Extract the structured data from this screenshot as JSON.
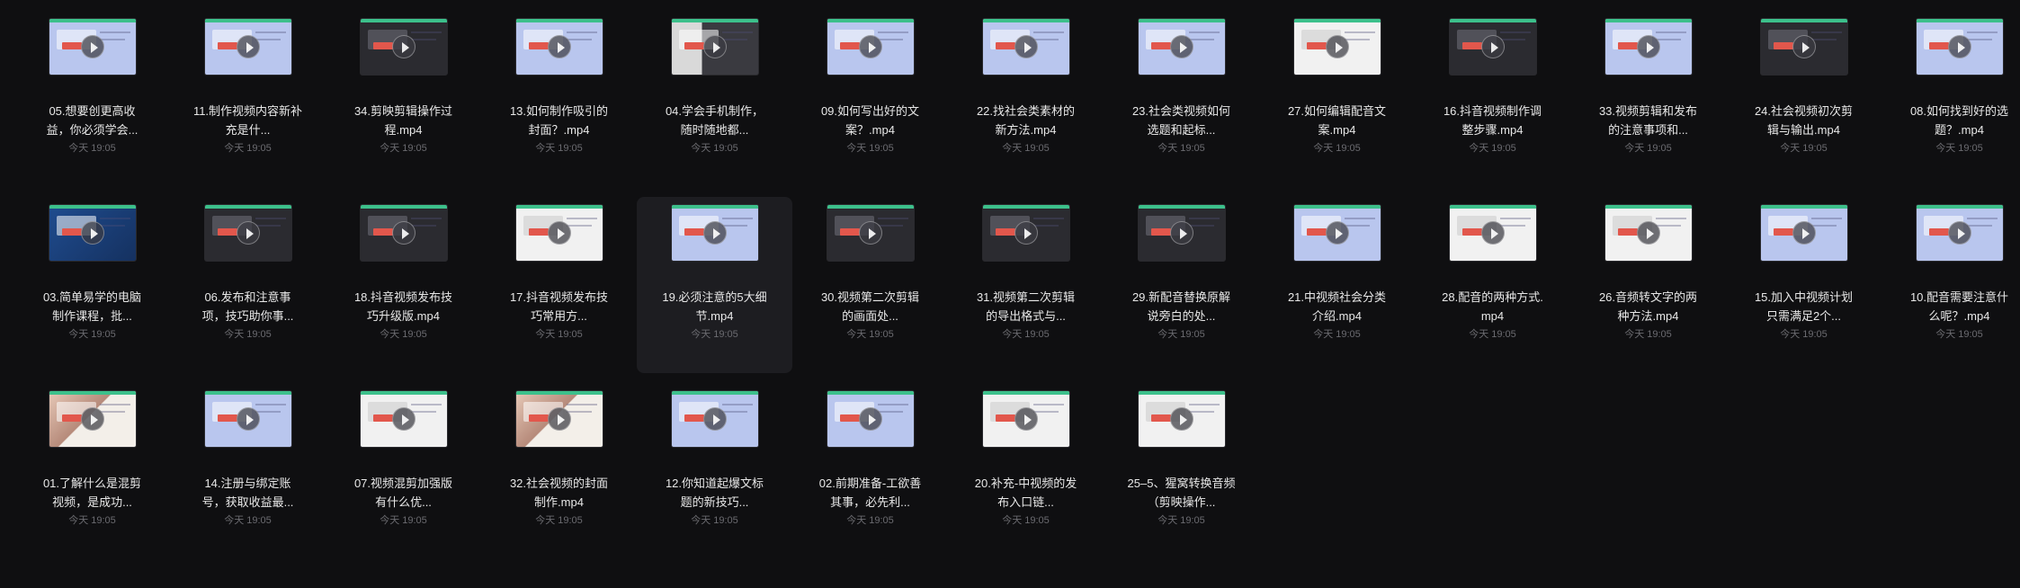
{
  "files": [
    {
      "name": "05.想要创更高收益，你必须学会...",
      "time": "今天 19:05",
      "style": "blue",
      "selected": false
    },
    {
      "name": "11.制作视频内容新补充是什...",
      "time": "今天 19:05",
      "style": "blue",
      "selected": false
    },
    {
      "name": "34.剪映剪辑操作过程.mp4",
      "time": "今天 19:05",
      "style": "dark",
      "selected": false
    },
    {
      "name": "13.如何制作吸引的封面？.mp4",
      "time": "今天 19:05",
      "style": "blue",
      "selected": false
    },
    {
      "name": "04.学会手机制作，随时随地都...",
      "time": "今天 19:05",
      "style": "mixed",
      "selected": false
    },
    {
      "name": "09.如何写出好的文案？.mp4",
      "time": "今天 19:05",
      "style": "blue",
      "selected": false
    },
    {
      "name": "22.找社会类素材的新方法.mp4",
      "time": "今天 19:05",
      "style": "blue",
      "selected": false
    },
    {
      "name": "23.社会类视频如何选题和起标...",
      "time": "今天 19:05",
      "style": "blue",
      "selected": false
    },
    {
      "name": "27.如何编辑配音文案.mp4",
      "time": "今天 19:05",
      "style": "white",
      "selected": false
    },
    {
      "name": "16.抖音视频制作调整步骤.mp4",
      "time": "今天 19:05",
      "style": "dark",
      "selected": false
    },
    {
      "name": "33.视频剪辑和发布的注意事项和...",
      "time": "今天 19:05",
      "style": "blue",
      "selected": false
    },
    {
      "name": "24.社会视频初次剪辑与输出.mp4",
      "time": "今天 19:05",
      "style": "dark",
      "selected": false
    },
    {
      "name": "08.如何找到好的选题？.mp4",
      "time": "今天 19:05",
      "style": "blue",
      "selected": false
    },
    {
      "name": "03.简单易学的电脑制作课程，批...",
      "time": "今天 19:05",
      "style": "desktop",
      "selected": false
    },
    {
      "name": "06.发布和注意事项，技巧助你事...",
      "time": "今天 19:05",
      "style": "dark",
      "selected": false
    },
    {
      "name": "18.抖音视频发布技巧升级版.mp4",
      "time": "今天 19:05",
      "style": "dark",
      "selected": false
    },
    {
      "name": "17.抖音视频发布技巧常用方...",
      "time": "今天 19:05",
      "style": "white",
      "selected": false
    },
    {
      "name": "19.必须注意的5大细节.mp4",
      "time": "今天 19:05",
      "style": "blue",
      "selected": true
    },
    {
      "name": "30.视频第二次剪辑的画面处...",
      "time": "今天 19:05",
      "style": "dark",
      "selected": false
    },
    {
      "name": "31.视频第二次剪辑的导出格式与...",
      "time": "今天 19:05",
      "style": "dark",
      "selected": false
    },
    {
      "name": "29.新配音替换原解说旁白的处...",
      "time": "今天 19:05",
      "style": "dark",
      "selected": false
    },
    {
      "name": "21.中视频社会分类介绍.mp4",
      "time": "今天 19:05",
      "style": "blue",
      "selected": false
    },
    {
      "name": "28.配音的两种方式.mp4",
      "time": "今天 19:05",
      "style": "white",
      "selected": false
    },
    {
      "name": "26.音频转文字的两种方法.mp4",
      "time": "今天 19:05",
      "style": "white",
      "selected": false
    },
    {
      "name": "15.加入中视频计划只需满足2个...",
      "time": "今天 19:05",
      "style": "blue",
      "selected": false
    },
    {
      "name": "10.配音需要注意什么呢？.mp4",
      "time": "今天 19:05",
      "style": "blue",
      "selected": false
    },
    {
      "name": "01.了解什么是混剪视频，是成功...",
      "time": "今天 19:05",
      "style": "photo",
      "selected": false
    },
    {
      "name": "14.注册与绑定账号，获取收益最...",
      "time": "今天 19:05",
      "style": "blue",
      "selected": false
    },
    {
      "name": "07.视频混剪加强版有什么优...",
      "time": "今天 19:05",
      "style": "white",
      "selected": false
    },
    {
      "name": "32.社会视频的封面制作.mp4",
      "time": "今天 19:05",
      "style": "photo",
      "selected": false
    },
    {
      "name": "12.你知道起爆文标题的新技巧...",
      "time": "今天 19:05",
      "style": "blue",
      "selected": false
    },
    {
      "name": "02.前期准备-工欲善其事，必先利...",
      "time": "今天 19:05",
      "style": "blue",
      "selected": false
    },
    {
      "name": "20.补充-中视频的发布入口链...",
      "time": "今天 19:05",
      "style": "white",
      "selected": false
    },
    {
      "name": "25–5、猩窝转换音频（剪映操作...",
      "time": "今天 19:05",
      "style": "white",
      "selected": false
    }
  ]
}
